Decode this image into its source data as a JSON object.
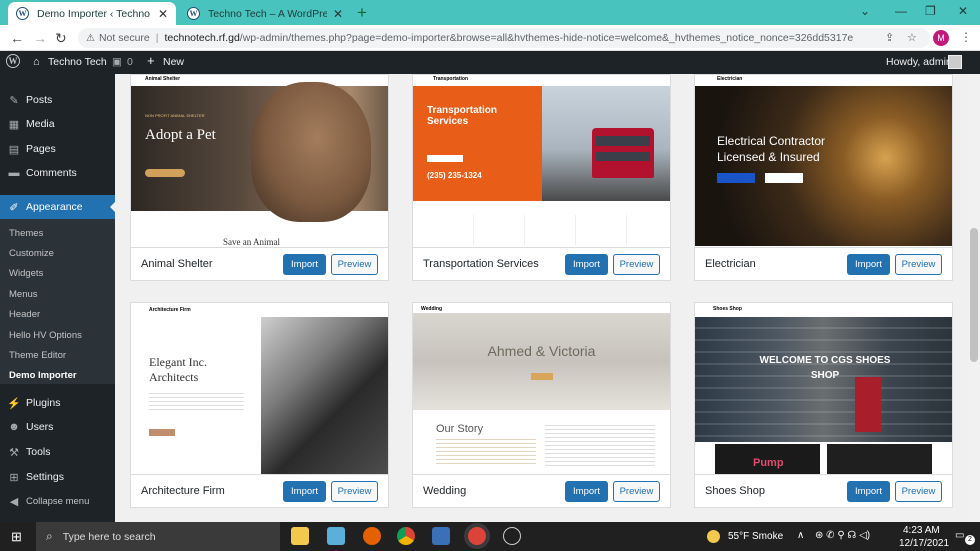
{
  "browser": {
    "tabs": [
      {
        "title": "Demo Importer ‹ Techno Tech —",
        "favicon": "wordpress-icon"
      },
      {
        "title": "Techno Tech – A WordPress Guy",
        "favicon": "wordpress-icon"
      }
    ],
    "new_tab": "+",
    "url_warning": "Not secure",
    "url_domain": "technotech.rf.gd",
    "url_path": "/wp-admin/themes.php?page=demo-importer&browse=all&hvthemes-hide-notice=welcome&_hvthemes_notice_nonce=326dd5317e",
    "profile_initial": "M"
  },
  "adminbar": {
    "site_name": "Techno Tech",
    "comments_count": "0",
    "new_label": "New",
    "howdy": "Howdy, admin"
  },
  "sidebar": {
    "items": [
      {
        "label": "Posts",
        "icon": "pin-icon"
      },
      {
        "label": "Media",
        "icon": "media-icon"
      },
      {
        "label": "Pages",
        "icon": "page-icon"
      },
      {
        "label": "Comments",
        "icon": "comment-icon"
      },
      {
        "label": "Appearance",
        "icon": "brush-icon"
      },
      {
        "label": "Plugins",
        "icon": "plug-icon"
      },
      {
        "label": "Users",
        "icon": "user-icon"
      },
      {
        "label": "Tools",
        "icon": "wrench-icon"
      },
      {
        "label": "Settings",
        "icon": "settings-icon"
      },
      {
        "label": "Collapse menu",
        "icon": "collapse-icon"
      }
    ],
    "submenu": [
      "Themes",
      "Customize",
      "Widgets",
      "Menus",
      "Header",
      "Hello HV Options",
      "Theme Editor",
      "Demo Importer"
    ]
  },
  "themes": [
    {
      "name": "Animal Shelter",
      "import": "Import",
      "preview": "Preview",
      "hero": "Adopt a Pet",
      "tagline": "NON PROFIT ANIMAL SHELTER",
      "sub": "Save an Animal",
      "brand": "Animal Shelter"
    },
    {
      "name": "Transportation Services",
      "import": "Import",
      "preview": "Preview",
      "hero": "Transportation Services",
      "phone": "(235) 235-1324",
      "brand": "Transportation"
    },
    {
      "name": "Electrician",
      "import": "Import",
      "preview": "Preview",
      "hero": "Electrical Contractor Licensed & Insured",
      "brand": "Electrician"
    },
    {
      "name": "Architecture Firm",
      "import": "Import",
      "preview": "Preview",
      "hero": "Elegant Inc. Architects",
      "brand": "Architecture Firm"
    },
    {
      "name": "Wedding",
      "import": "Import",
      "preview": "Preview",
      "hero": "Ahmed & Victoria",
      "sub": "Our Story",
      "brand": "Wedding"
    },
    {
      "name": "Shoes Shop",
      "import": "Import",
      "preview": "Preview",
      "hero": "WELCOME TO CGS SHOES SHOP",
      "badge": "Pump",
      "brand": "Shoes Shop"
    }
  ],
  "taskbar": {
    "search_placeholder": "Type here to search",
    "weather": "55°F  Smoke",
    "time": "4:23 AM",
    "date": "12/17/2021",
    "notifications": "2"
  }
}
